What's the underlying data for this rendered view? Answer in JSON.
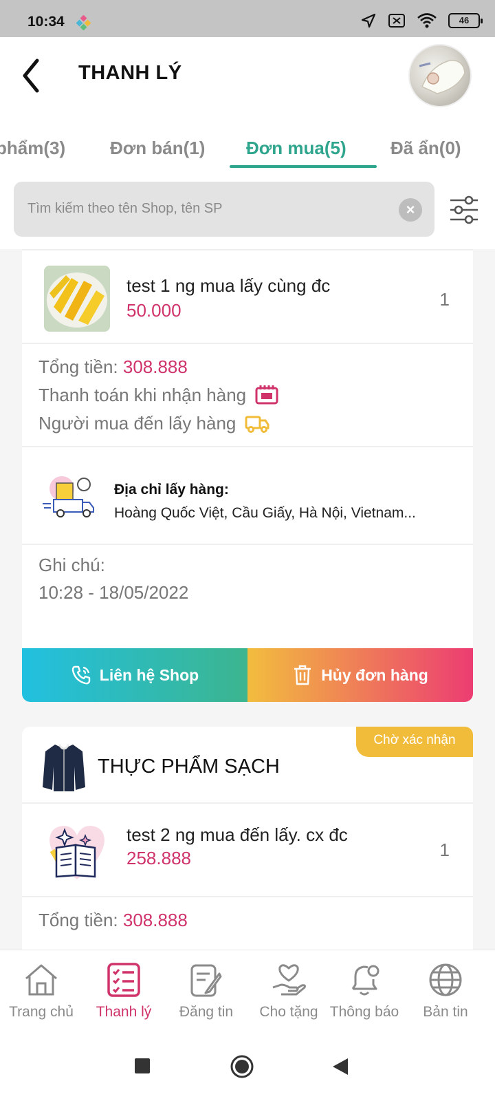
{
  "status_bar": {
    "time": "10:34",
    "battery": "46"
  },
  "header": {
    "title": "THANH LÝ"
  },
  "tabs": [
    {
      "label": "phẩm(3)"
    },
    {
      "label": "Đơn bán(1)"
    },
    {
      "label": "Đơn mua(5)"
    },
    {
      "label": "Đã ẩn(0)"
    }
  ],
  "search": {
    "placeholder": "Tìm kiếm theo tên Shop, tên SP",
    "clear_symbol": "×"
  },
  "orders": [
    {
      "product": {
        "name": "test 1 ng mua lấy cùng đc",
        "price": "50.000",
        "qty": "1"
      },
      "total_label": "Tổng tiền: ",
      "total_value": "308.888",
      "payment": "Thanh toán khi nhận hàng",
      "delivery": "Người mua đến lấy hàng",
      "address_label": "Địa chỉ lấy hàng:",
      "address": "Hoàng Quốc Việt, Cầu Giấy, Hà Nội, Vietnam...",
      "note_label": "Ghi chú:",
      "note_time": "10:28 - 18/05/2022",
      "contact_button": "Liên hệ Shop",
      "cancel_button": "Hủy đơn hàng"
    },
    {
      "status": "Chờ xác nhận",
      "shop_name": "THỰC PHẨM SẠCH",
      "product": {
        "name": "test 2 ng mua đến lấy. cx đc",
        "price": "258.888",
        "qty": "1"
      },
      "total_label": "Tổng tiền: ",
      "total_value": "308.888"
    }
  ],
  "bottom_nav": [
    {
      "label": "Trang chủ",
      "icon": "home-icon"
    },
    {
      "label": "Thanh lý",
      "icon": "checklist-icon",
      "active": true
    },
    {
      "label": "Đăng tin",
      "icon": "post-edit-icon"
    },
    {
      "label": "Cho tặng",
      "icon": "gift-heart-hand-icon"
    },
    {
      "label": "Thông báo",
      "icon": "bell-icon"
    },
    {
      "label": "Bản tin",
      "icon": "globe-icon"
    }
  ],
  "colors": {
    "accent_green": "#2fa58d",
    "price_pink": "#d0336a",
    "badge_yellow": "#f2bc3b"
  }
}
